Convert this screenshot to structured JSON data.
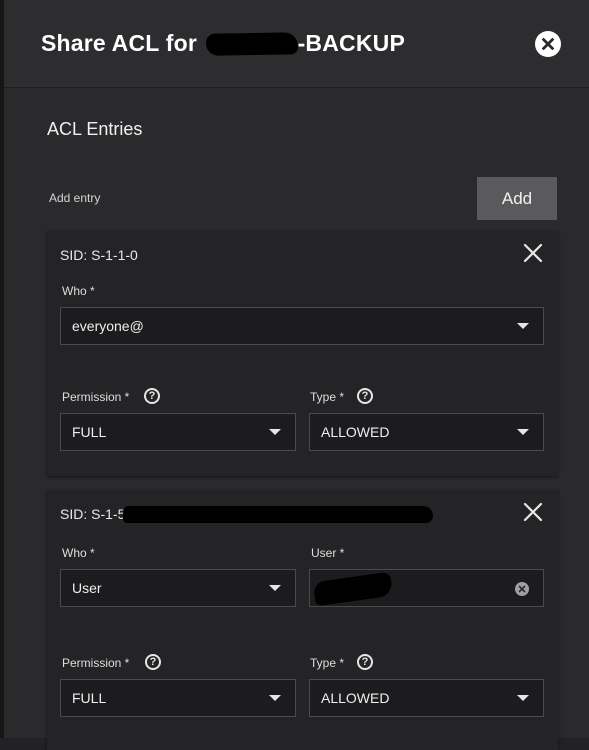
{
  "dialog": {
    "title_prefix": "Share ACL for",
    "title_suffix": "-BACKUP"
  },
  "section": {
    "title": "ACL Entries",
    "add_entry_label": "Add entry",
    "add_button": "Add"
  },
  "entries": [
    {
      "sid": "SID: S-1-1-0",
      "who_label": "Who *",
      "who_value": "everyone@",
      "permission_label": "Permission *",
      "permission_value": "FULL",
      "type_label": "Type *",
      "type_value": "ALLOWED"
    },
    {
      "sid_prefix": "SID: S-1-5",
      "who_label": "Who *",
      "who_value": "User",
      "user_label": "User *",
      "permission_label": "Permission *",
      "permission_value": "FULL",
      "type_label": "Type *",
      "type_value": "ALLOWED"
    }
  ],
  "help_glyph": "?",
  "icons": {
    "close_dialog": "close-circle-icon",
    "remove_entry": "close-icon",
    "dropdown": "caret-down-icon",
    "help": "help-circle-icon",
    "clear": "clear-circle-icon"
  }
}
